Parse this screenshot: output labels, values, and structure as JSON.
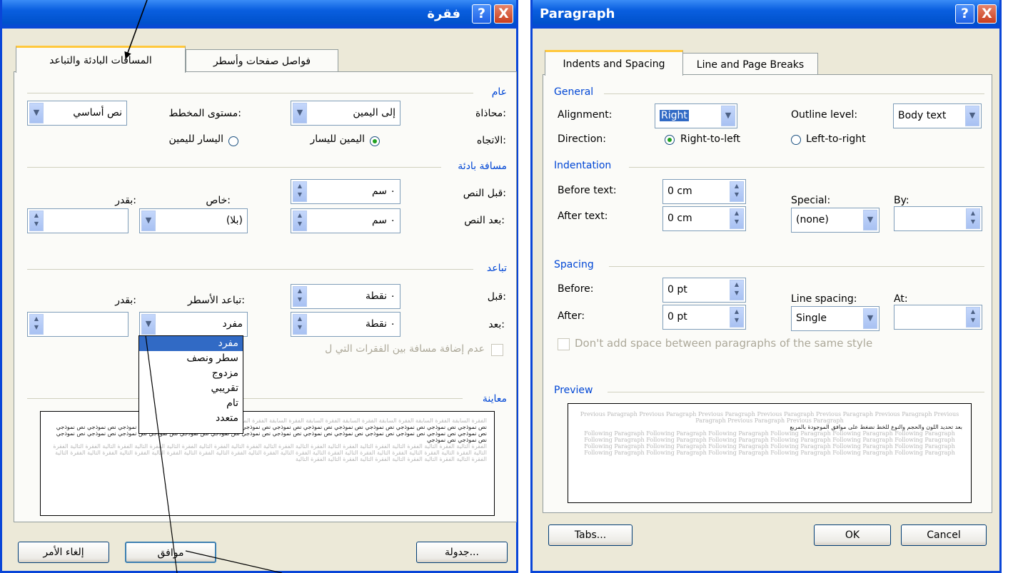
{
  "arabic_dialog": {
    "title": "فقرة",
    "help_icon": "?",
    "close_icon": "X",
    "tabs": [
      "المسافات البادئة والتباعد",
      "فواصل صفحات وأسطر"
    ],
    "general": {
      "heading": "عام",
      "alignment_label": "محاذاة:",
      "alignment_value": "إلى اليمين",
      "outline_label": "مستوى المخطط:",
      "outline_value": "نص أساسي",
      "direction_label": "الاتجاه:",
      "rtl_option": "اليمين لليسار",
      "ltr_option": "اليسار لليمين"
    },
    "indentation": {
      "heading": "مسافة بادئة",
      "before_label": "قبل النص:",
      "before_value": "٠ سم",
      "after_label": "بعد النص:",
      "after_value": "٠ سم",
      "special_label": "خاص:",
      "special_value": "(بلا)",
      "by_label": "بقدر:"
    },
    "spacing": {
      "heading": "تباعد",
      "before_label": "قبل:",
      "before_value": "٠ نقطة",
      "after_label": "بعد:",
      "after_value": "٠ نقطة",
      "line_spacing_label": "تباعد الأسطر:",
      "line_spacing_value": "مفرد",
      "at_label": "بقدر:",
      "dont_add": "عدم إضافة مسافة بين الفقرات التي ل"
    },
    "line_spacing_options": [
      "مفرد",
      "سطر ونصف",
      "مزدوج",
      "تقريبي",
      "تام",
      "متعدد"
    ],
    "preview": {
      "heading": "معاينة",
      "previous": "الفقرة السابقة الفقرة السابقة الفقرة السابقة الفقرة السابقة الفقرة السابقة الفقرة السابقة الفقرة السابقة الفقرة السابقة الفقرة السابقة الفقرة",
      "sample": "نص نموذجي نص نموذجي نص نموذجي نص نموذجي نص نموذجي نص نموذجي نص نموذجي نص نموذجي نص نموذجي نص نموذجي نص نموذجي نص نموذجي نص نموذجي نص نموذجي نص نموذجي نص نموذجي نص نموذجي نص نموذجي نص نموذجي نص نموذجي نص نموذجي نص نموذجي نص نموذجي نص نموذجي نص نموذجي نص نموذجي نص نموذجي نص نموذجي نص نموذجي نص نموذجي",
      "following": "الفقرة التالية الفقرة التالية الفقرة التالية الفقرة التالية الفقرة التالية الفقرة التالية الفقرة التالية الفقرة التالية الفقرة التالية الفقرة التالية الفقرة التالية الفقرة التالية الفقرة التالية الفقرة التالية الفقرة التالية الفقرة التالية الفقرة التالية الفقرة التالية الفقرة التالية الفقرة التالية الفقرة التالية الفقرة التالية الفقرة التالية الفقرة التالية الفقرة التالية الفقرة التالية الفقرة التالية الفقرة التالية الفقرة التالية الفقرة التالية الفقرة التالية الفقرة التالية الفقرة التالية"
    },
    "buttons": {
      "tabs": "جدولة...",
      "ok": "موافق",
      "cancel": "إلغاء الأمر"
    }
  },
  "english_dialog": {
    "title": "Paragraph",
    "help_icon": "?",
    "close_icon": "X",
    "tabs": [
      "Indents and Spacing",
      "Line and Page Breaks"
    ],
    "general": {
      "heading": "General",
      "alignment_label": "Alignment:",
      "alignment_value": "Right",
      "outline_label": "Outline level:",
      "outline_value": "Body text",
      "direction_label": "Direction:",
      "rtl_option": "Right-to-left",
      "ltr_option": "Left-to-right"
    },
    "indentation": {
      "heading": "Indentation",
      "before_label": "Before text:",
      "before_value": "0 cm",
      "after_label": "After text:",
      "after_value": "0 cm",
      "special_label": "Special:",
      "special_value": "(none)",
      "by_label": "By:"
    },
    "spacing": {
      "heading": "Spacing",
      "before_label": "Before:",
      "before_value": "0 pt",
      "after_label": "After:",
      "after_value": "0 pt",
      "line_spacing_label": "Line spacing:",
      "line_spacing_value": "Single",
      "at_label": "At:",
      "dont_add": "Don't add space between paragraphs of the same style"
    },
    "preview": {
      "heading": "Preview",
      "previous": "Previous Paragraph Previous Paragraph Previous Paragraph Previous Paragraph Previous Paragraph Previous Paragraph Previous Paragraph Previous Paragraph Previous Paragraph",
      "sample": "بعد تحديد اللون والحجم والنوع للخط نضغط على موافق الموجودة بالمربع",
      "following": "Following Paragraph Following Paragraph Following Paragraph Following Paragraph Following Paragraph Following Paragraph Following Paragraph Following Paragraph Following Paragraph Following Paragraph Following Paragraph Following Paragraph Following Paragraph Following Paragraph Following Paragraph Following Paragraph Following Paragraph Following Paragraph Following Paragraph Following Paragraph Following Paragraph Following Paragraph Following Paragraph Following Paragraph"
    },
    "buttons": {
      "tabs": "Tabs...",
      "ok": "OK",
      "cancel": "Cancel"
    }
  },
  "colors": {
    "titlebar": "#0a5fe0",
    "face": "#ece9d8",
    "section": "#0046d5",
    "selection": "#316ac5",
    "tab_highlight": "#ffc83c"
  }
}
